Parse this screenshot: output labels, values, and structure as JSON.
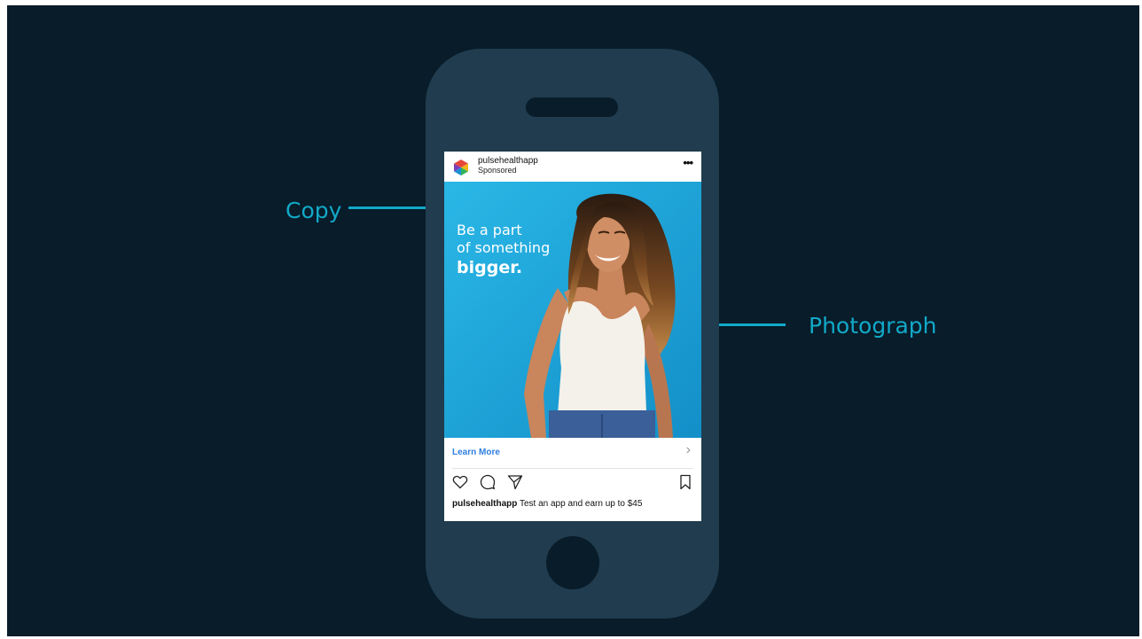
{
  "slide": {
    "annotations": {
      "copy_label": "Copy",
      "photo_label": "Photograph"
    }
  },
  "post": {
    "account": "pulsehealthapp",
    "sponsored": "Sponsored",
    "more_icon": "ellipsis-icon",
    "ad_copy": {
      "line1": "Be a part",
      "line2": "of something",
      "line3": "bigger."
    },
    "cta": {
      "label": "Learn More",
      "arrow": "›"
    },
    "actions": [
      "heart-icon",
      "comment-icon",
      "send-icon",
      "bookmark-icon"
    ],
    "caption": {
      "account": "pulsehealthapp",
      "text": " Test an app and earn up to $45"
    }
  },
  "colors": {
    "slide_background": "#081c2a",
    "phone_body": "#203c4e",
    "accent": "#12a9c8",
    "photo_background": "#1fa9dc",
    "cta_link": "#2f7fe0"
  }
}
